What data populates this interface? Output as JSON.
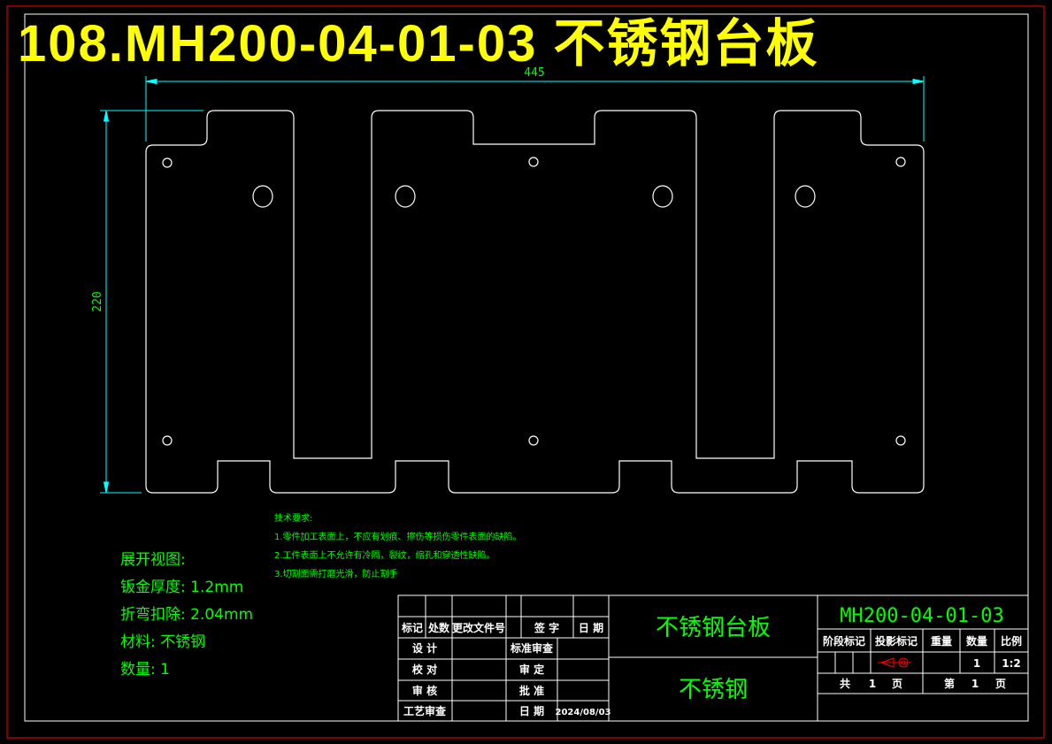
{
  "title": "108.MH200-04-01-03 不锈钢台板",
  "dimensions": {
    "width": "445",
    "height": "220"
  },
  "unfold_info": {
    "heading": "展开视图:",
    "thickness": "钣金厚度: 1.2mm",
    "bend_deduction": "折弯扣除: 2.04mm",
    "material": "材料: 不锈钢",
    "quantity": "数量: 1"
  },
  "tech_req": {
    "heading": "技术要求:",
    "item1": "1.零件加工表面上，不应有划痕、擦伤等损伤零件表面的缺陷。",
    "item2": "2.工件表面上不允许有冷隔，裂纹，缩孔和穿透性缺陷。",
    "item3": "3.切割面需打磨光滑，防止割手"
  },
  "title_block": {
    "part_name": "不锈钢台板",
    "material": "不锈钢",
    "drawing_no": "MH200-04-01-03",
    "header_cells": [
      "标记",
      "处数",
      "更改文件号",
      "签 字",
      "日 期"
    ],
    "design": "设 计",
    "check": "校 对",
    "review": "审 核",
    "process": "工艺审查",
    "std_review": "标准审查",
    "approve_fix": "审 定",
    "approve": "批 准",
    "date_label": "日 期",
    "date_value": "2024/08/03",
    "stage_mark": "阶段标记",
    "projection_mark": "投影标记",
    "weight": "重量",
    "qty_label": "数量",
    "scale_label": "比例",
    "qty_value": "1",
    "scale_value": "1:2",
    "total_label": "共",
    "total_value": "1",
    "page_unit": "页",
    "sheet_label": "第",
    "sheet_value": "1",
    "sheet_unit": "页"
  },
  "colors": {
    "outline": "#ffffff",
    "dimension": "#00ffff",
    "text_green": "#00ff00",
    "title_yellow": "#ffff00",
    "frame_red": "#ff0000",
    "projection": "#ff0000"
  }
}
